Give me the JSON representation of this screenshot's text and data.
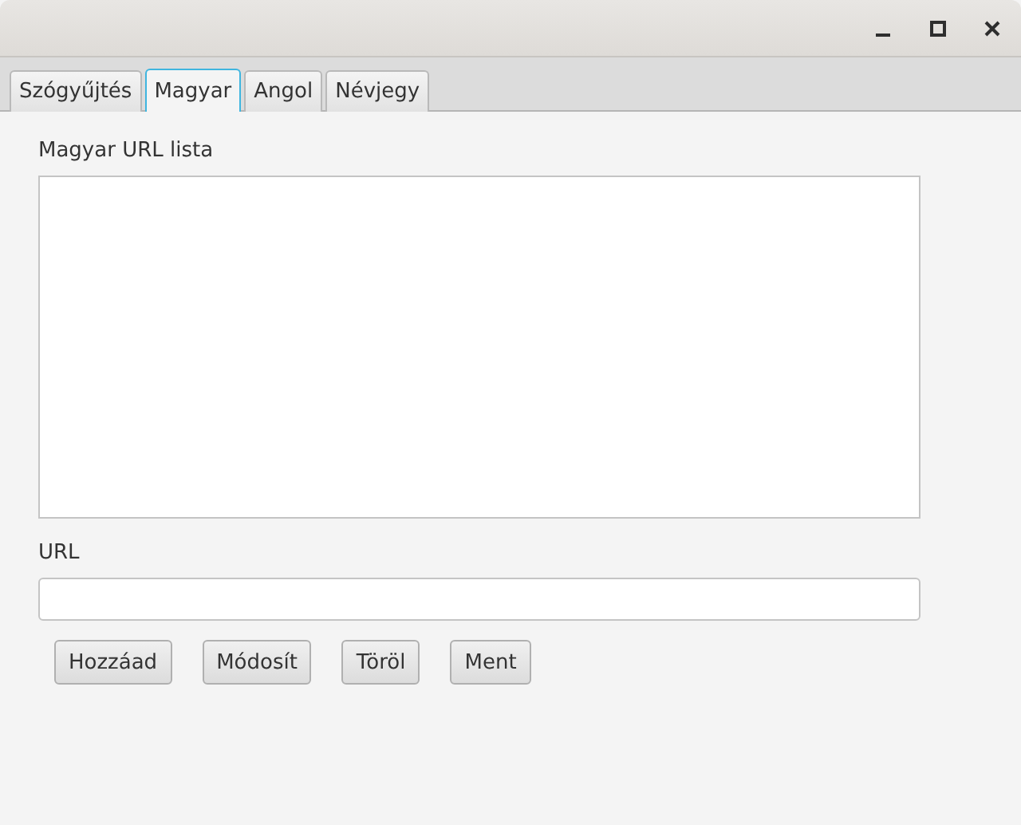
{
  "tabs": [
    {
      "label": "Szógyűjtés",
      "selected": false
    },
    {
      "label": "Magyar",
      "selected": true
    },
    {
      "label": "Angol",
      "selected": false
    },
    {
      "label": "Névjegy",
      "selected": false
    }
  ],
  "list": {
    "label": "Magyar URL lista"
  },
  "url": {
    "label": "URL"
  },
  "buttons": [
    "Hozzáad",
    "Módosít",
    "Töröl",
    "Ment"
  ]
}
